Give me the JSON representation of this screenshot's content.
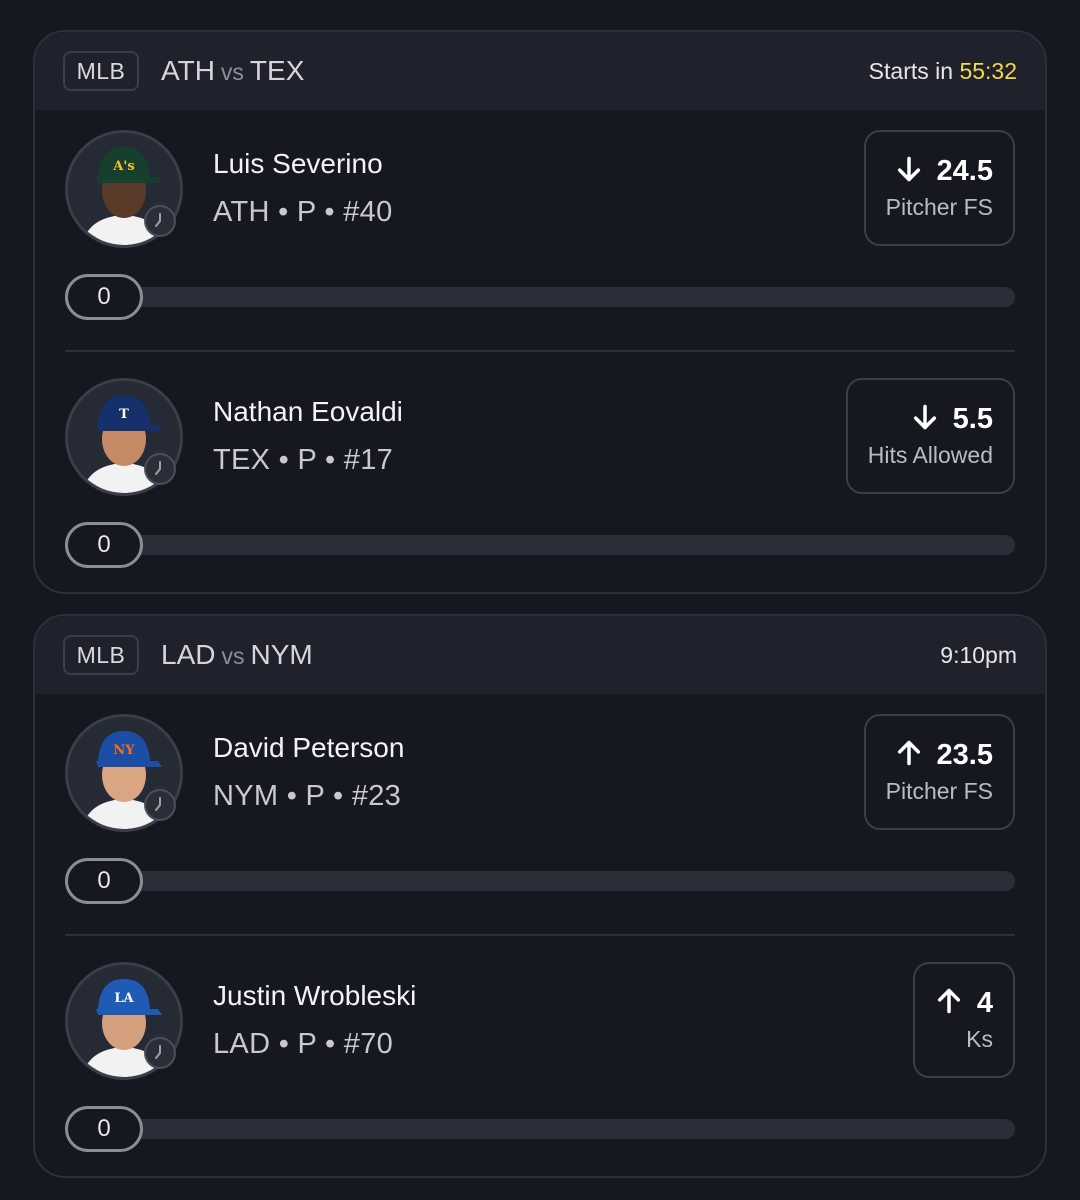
{
  "games": [
    {
      "league": "MLB",
      "away": "ATH",
      "vs": "vs",
      "home": "TEX",
      "status_prefix": "Starts in ",
      "status_value": "55:32",
      "players": [
        {
          "name": "Luis Severino",
          "team": "ATH",
          "position": "P",
          "number": "#40",
          "direction": "down",
          "line": "24.5",
          "stat": "Pitcher FS",
          "progress": "0"
        },
        {
          "name": "Nathan Eovaldi",
          "team": "TEX",
          "position": "P",
          "number": "#17",
          "direction": "down",
          "line": "5.5",
          "stat": "Hits Allowed",
          "progress": "0"
        }
      ]
    },
    {
      "league": "MLB",
      "away": "LAD",
      "vs": "vs",
      "home": "NYM",
      "status_prefix": "",
      "status_value": "9:10pm",
      "players": [
        {
          "name": "David Peterson",
          "team": "NYM",
          "position": "P",
          "number": "#23",
          "direction": "up",
          "line": "23.5",
          "stat": "Pitcher FS",
          "progress": "0"
        },
        {
          "name": "Justin Wrobleski",
          "team": "LAD",
          "position": "P",
          "number": "#70",
          "direction": "up",
          "line": "4",
          "stat": "Ks",
          "progress": "0"
        }
      ]
    }
  ],
  "meta_separator": "•",
  "colors": {
    "countdown": "#f4d84a",
    "background": "#151821",
    "header": "#1f222c",
    "border": "#2c303b"
  },
  "avatars": [
    {
      "cap": "#173f2e",
      "logo": "A's",
      "logo_color": "#f2c230",
      "skin": "#5a3a28"
    },
    {
      "cap": "#15306a",
      "logo": "T",
      "logo_color": "#ffffff",
      "skin": "#c58a66"
    },
    {
      "cap": "#1c4ea3",
      "logo": "NY",
      "logo_color": "#ff6a13",
      "skin": "#d9a582"
    },
    {
      "cap": "#1f5bb5",
      "logo": "LA",
      "logo_color": "#ffffff",
      "skin": "#d4a07e"
    }
  ]
}
